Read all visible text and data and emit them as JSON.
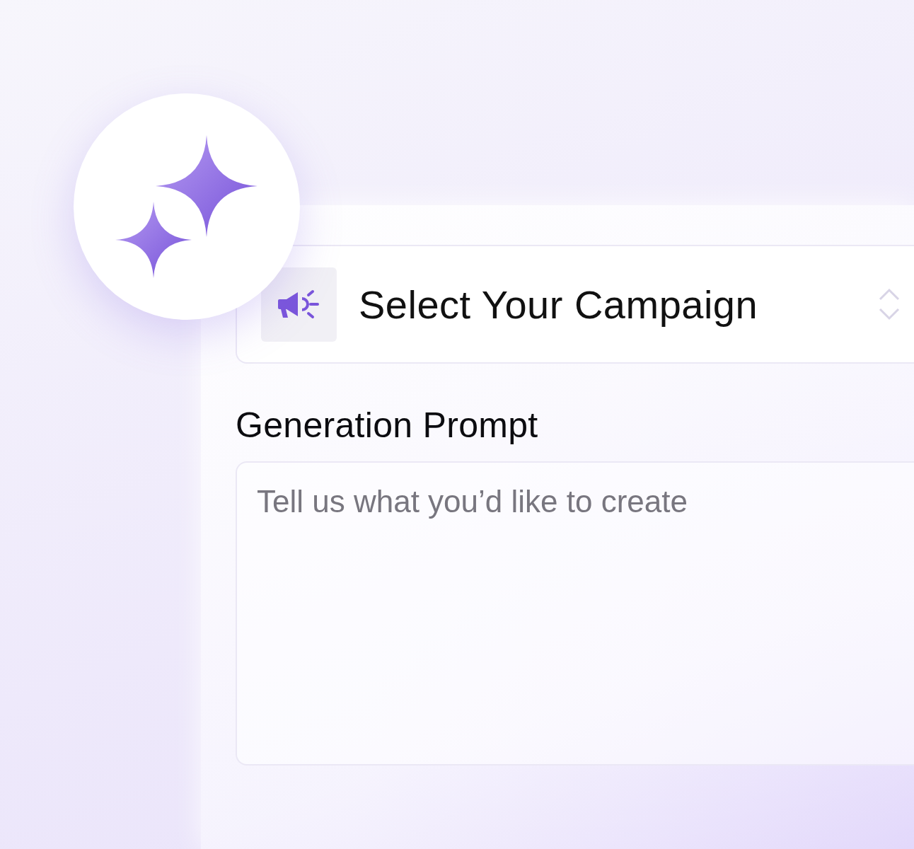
{
  "campaign_select": {
    "label": "Select Your Campaign"
  },
  "prompt": {
    "label": "Generation Prompt",
    "placeholder": "Tell us what you’d like to create"
  }
}
